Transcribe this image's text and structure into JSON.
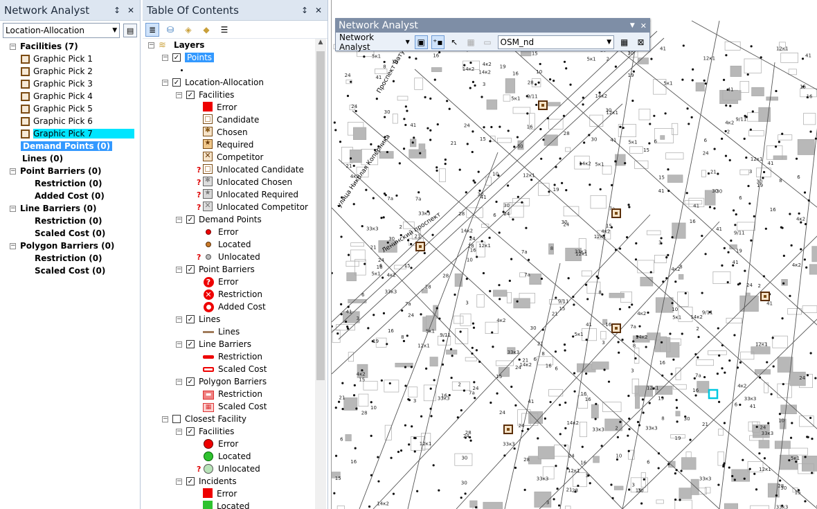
{
  "na_panel": {
    "title": "Network Analyst",
    "pin": "↕",
    "close": "✕",
    "layer_select": "Location-Allocation",
    "items": [
      {
        "label": "Facilities (7)",
        "kind": "group"
      },
      {
        "label": "Graphic Pick 1",
        "kind": "fac"
      },
      {
        "label": "Graphic Pick 2",
        "kind": "fac"
      },
      {
        "label": "Graphic Pick 3",
        "kind": "fac"
      },
      {
        "label": "Graphic Pick 4",
        "kind": "fac"
      },
      {
        "label": "Graphic Pick 5",
        "kind": "fac"
      },
      {
        "label": "Graphic Pick 6",
        "kind": "fac"
      },
      {
        "label": "Graphic Pick 7",
        "kind": "fac-sel"
      },
      {
        "label": "Demand Points (0)",
        "kind": "sel"
      },
      {
        "label": "Lines (0)",
        "kind": "plain"
      },
      {
        "label": "Point Barriers (0)",
        "kind": "group"
      },
      {
        "label": "Restriction (0)",
        "kind": "sub"
      },
      {
        "label": "Added Cost (0)",
        "kind": "sub"
      },
      {
        "label": "Line Barriers (0)",
        "kind": "group"
      },
      {
        "label": "Restriction (0)",
        "kind": "sub"
      },
      {
        "label": "Scaled Cost (0)",
        "kind": "sub"
      },
      {
        "label": "Polygon Barriers (0)",
        "kind": "group"
      },
      {
        "label": "Restriction (0)",
        "kind": "sub"
      },
      {
        "label": "Scaled Cost (0)",
        "kind": "sub"
      }
    ]
  },
  "toc": {
    "title": "Table Of Contents",
    "pin": "↕",
    "close": "✕",
    "items": [
      {
        "label": "Layers",
        "lvl": 0,
        "exp": "−",
        "chk": null,
        "sym": "layers",
        "bold": true
      },
      {
        "label": "Points",
        "lvl": 1,
        "exp": "−",
        "chk": true,
        "sym": null,
        "sel": true
      },
      {
        "label": "",
        "lvl": 2,
        "exp": null,
        "chk": null,
        "sym": "dot"
      },
      {
        "label": "Location-Allocation",
        "lvl": 1,
        "exp": "−",
        "chk": true,
        "sym": null
      },
      {
        "label": "Facilities",
        "lvl": 2,
        "exp": "−",
        "chk": true,
        "sym": null
      },
      {
        "label": "Error",
        "lvl": 3,
        "sym": "sq-red"
      },
      {
        "label": "Candidate",
        "lvl": 3,
        "sym": "sq-cand"
      },
      {
        "label": "Chosen",
        "lvl": 3,
        "sym": "sq-chosen"
      },
      {
        "label": "Required",
        "lvl": 3,
        "sym": "sq-req"
      },
      {
        "label": "Competitor",
        "lvl": 3,
        "sym": "sq-comp"
      },
      {
        "label": "Unlocated Candidate",
        "lvl": 3,
        "sym": "sq-cand",
        "q": "?"
      },
      {
        "label": "Unlocated Chosen",
        "lvl": 3,
        "sym": "sq-chosen-g",
        "q": "?"
      },
      {
        "label": "Unlocated Required",
        "lvl": 3,
        "sym": "sq-req-g",
        "q": "?"
      },
      {
        "label": "Unlocated Competitor",
        "lvl": 3,
        "sym": "sq-comp-g",
        "q": "?"
      },
      {
        "label": "Demand Points",
        "lvl": 2,
        "exp": "−",
        "chk": true
      },
      {
        "label": "Error",
        "lvl": 3,
        "sym": "dot-red"
      },
      {
        "label": "Located",
        "lvl": 3,
        "sym": "dot-brown"
      },
      {
        "label": "Unlocated",
        "lvl": 3,
        "sym": "dot-gray",
        "q": "?"
      },
      {
        "label": "Point Barriers",
        "lvl": 2,
        "exp": "−",
        "chk": true
      },
      {
        "label": "Error",
        "lvl": 3,
        "sym": "pb-err"
      },
      {
        "label": "Restriction",
        "lvl": 3,
        "sym": "pb-res"
      },
      {
        "label": "Added Cost",
        "lvl": 3,
        "sym": "pb-add"
      },
      {
        "label": "Lines",
        "lvl": 2,
        "exp": "−",
        "chk": true
      },
      {
        "label": "Lines",
        "lvl": 3,
        "sym": "line-brown"
      },
      {
        "label": "Line Barriers",
        "lvl": 2,
        "exp": "−",
        "chk": true
      },
      {
        "label": "Restriction",
        "lvl": 3,
        "sym": "line-red"
      },
      {
        "label": "Scaled Cost",
        "lvl": 3,
        "sym": "line-redw"
      },
      {
        "label": "Polygon Barriers",
        "lvl": 2,
        "exp": "−",
        "chk": true
      },
      {
        "label": "Restriction",
        "lvl": 3,
        "sym": "poly-res"
      },
      {
        "label": "Scaled Cost",
        "lvl": 3,
        "sym": "poly-sc"
      },
      {
        "label": "Closest Facility",
        "lvl": 1,
        "exp": "−",
        "chk": false
      },
      {
        "label": "Facilities",
        "lvl": 2,
        "exp": "−",
        "chk": true
      },
      {
        "label": "Error",
        "lvl": 3,
        "sym": "circ-red"
      },
      {
        "label": "Located",
        "lvl": 3,
        "sym": "circ-green"
      },
      {
        "label": "Unlocated",
        "lvl": 3,
        "sym": "circ-lgreen",
        "q": "?"
      },
      {
        "label": "Incidents",
        "lvl": 2,
        "exp": "−",
        "chk": true
      },
      {
        "label": "Error",
        "lvl": 3,
        "sym": "sq-red"
      },
      {
        "label": "Located",
        "lvl": 3,
        "sym": "sq-green"
      }
    ]
  },
  "na_toolbar": {
    "title": "Network Analyst",
    "menu": "Network Analyst",
    "dataset": "OSM_nd"
  },
  "map": {
    "street_labels": [
      "улица Николая Коперника",
      "Проспект Ватутина",
      "Ленинский проспект"
    ]
  }
}
